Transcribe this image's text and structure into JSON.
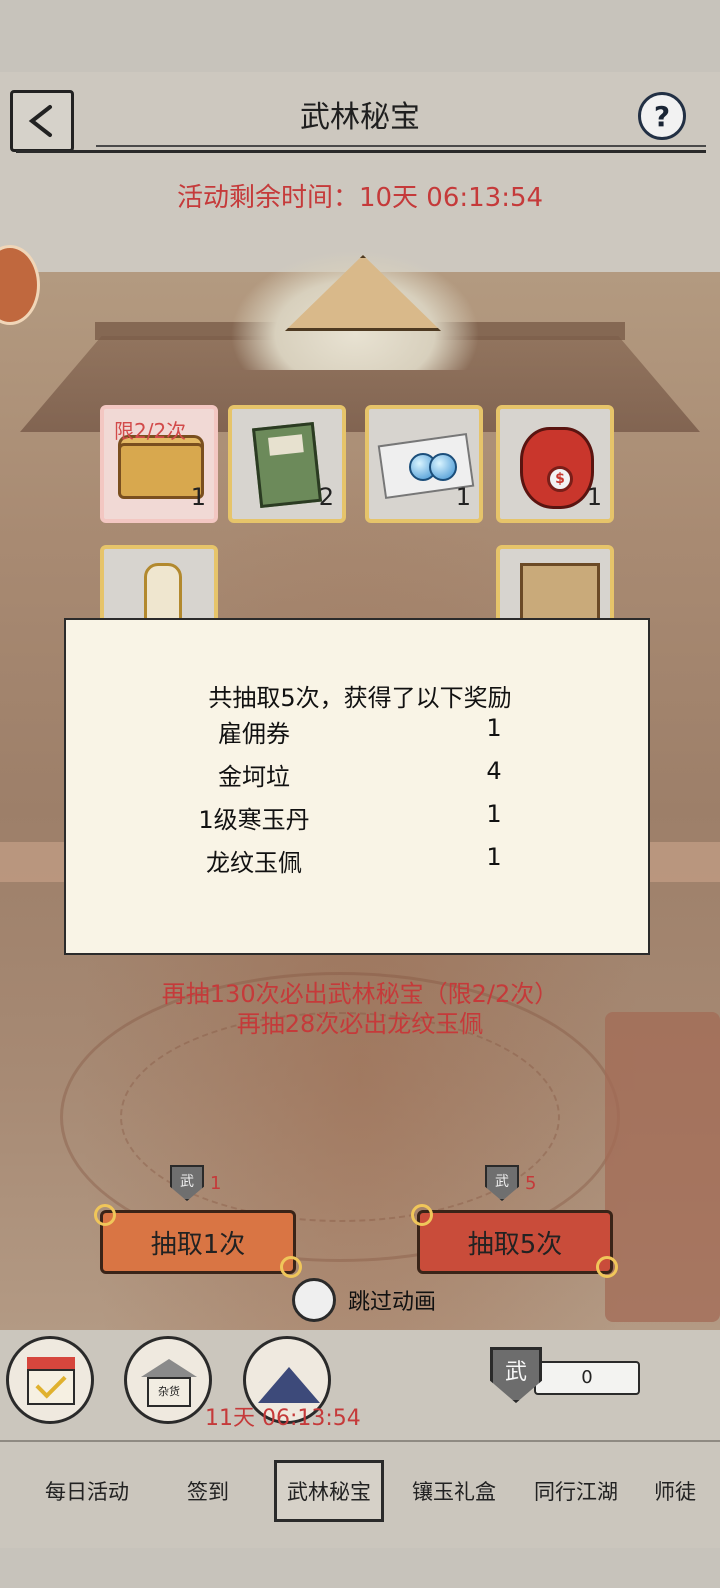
{
  "header": {
    "title": "武林秘宝",
    "help_symbol": "?",
    "timer_label": "活动剩余时间：10天 06:13:54"
  },
  "prize_grid": {
    "items": [
      {
        "name": "武林秘宝宝箱",
        "qty": "1",
        "limit": "限2/2次",
        "icon": "treasure-chest-icon"
      },
      {
        "name": "金坷垃",
        "qty": "2",
        "icon": "book-icon"
      },
      {
        "name": "寒玉丹",
        "qty": "1",
        "icon": "pearls-icon"
      },
      {
        "name": "钱袋",
        "qty": "1",
        "icon": "money-bag-icon"
      },
      {
        "name": "令牌",
        "qty": "",
        "icon": "plaque-icon"
      },
      {
        "name": "雇佣券",
        "qty": "",
        "icon": "scroll-icon"
      }
    ]
  },
  "result_modal": {
    "title": "共抽取5次，获得了以下奖励",
    "rewards": [
      {
        "name": "雇佣券",
        "qty": "1"
      },
      {
        "name": "金坷垃",
        "qty": "4"
      },
      {
        "name": "1级寒玉丹",
        "qty": "1"
      },
      {
        "name": "龙纹玉佩",
        "qty": "1"
      }
    ]
  },
  "pity": {
    "line1": "再抽130次必出武林秘宝（限2/2次）",
    "line2": "再抽28次必出龙纹玉佩"
  },
  "draw": {
    "one": {
      "label": "抽取1次",
      "cost": "1",
      "cost_icon": "wu-token-icon"
    },
    "five": {
      "label": "抽取5次",
      "cost": "5",
      "cost_icon": "wu-token-icon"
    }
  },
  "skip_animation_label": "跳过动画",
  "dock": {
    "timer": "11天 06:13:54",
    "shop_sign": "杂货",
    "currency_symbol": "武",
    "currency_amount": "0"
  },
  "tabs": [
    {
      "label": "每日活动"
    },
    {
      "label": "签到"
    },
    {
      "label": "武林秘宝",
      "active": true
    },
    {
      "label": "镶玉礼盒"
    },
    {
      "label": "同行江湖"
    },
    {
      "label": "师徒"
    }
  ],
  "colors": {
    "accent_red": "#c53a3a",
    "tile_border": "#e6c46a",
    "draw_one_button": "#d97544",
    "draw_five_button": "#c94c3a"
  }
}
